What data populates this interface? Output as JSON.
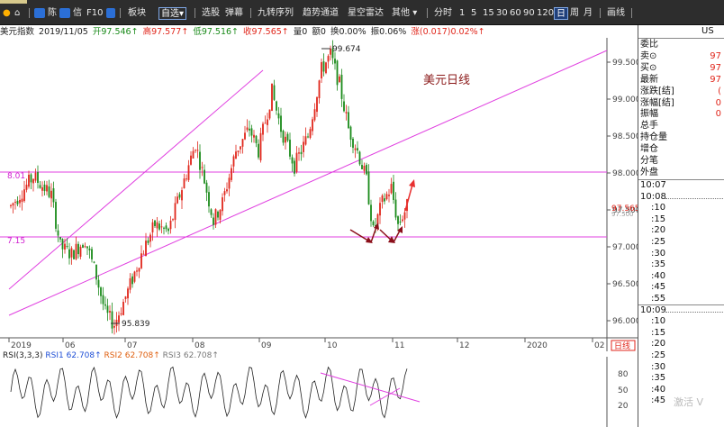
{
  "toolbar": {
    "items": [
      "板块",
      "自选",
      "选股",
      "弹幕",
      "九转序列",
      "趋势通道",
      "星空雷达",
      "其他"
    ],
    "icon_labels": [
      "陈",
      "信",
      "F10"
    ],
    "periods": [
      "分时",
      "1",
      "5",
      "15",
      "30",
      "60",
      "90",
      "120",
      "日",
      "周",
      "月"
    ],
    "active_period": "日",
    "draw_tool": "画线"
  },
  "info": {
    "title": "美元指数",
    "date": "2019/11/05",
    "open": "开97.546↑",
    "high": "高97.577↑",
    "low": "低97.516↑",
    "close": "收97.565↑",
    "volume": "量0",
    "amount": "额0",
    "change_pct": "换0.00%",
    "amplitude": "振0.06%",
    "change": "涨(0.017)0.02%↑"
  },
  "chart": {
    "annotation": "美元日线",
    "high_label": "99.674",
    "low_label": "95.839",
    "price_tag": "97.565",
    "price_tag_sub": "97.500",
    "left_label_upper": "8.01",
    "left_label_lower": "7.15",
    "period_badge": "日线",
    "colors": {
      "up": "#e0261b",
      "down": "#1a8a1a",
      "channel": "#e040e0",
      "arrow_dark": "#8b0f1a",
      "arrow_red": "#e83030"
    }
  },
  "chart_data": {
    "type": "candlestick",
    "title": "美元日线",
    "y_ticks": [
      "99.500",
      "99.000",
      "98.500",
      "98.000",
      "97.500",
      "97.000",
      "96.500",
      "96.000"
    ],
    "x_ticks": [
      "2019",
      "06",
      "07",
      "08",
      "09",
      "10",
      "11",
      "12",
      "2020",
      "02"
    ],
    "ylim": [
      95.7,
      100.0
    ],
    "high": 99.674,
    "low": 95.839,
    "last_close": 97.565,
    "horizontal_levels": [
      98.01,
      97.15
    ]
  },
  "rsi": {
    "label": "RSI(3,3,3)",
    "rsi1": "RSI1 62.708↑",
    "rsi2": "RSI2 62.708↑",
    "rsi3": "RSI3 62.708↑",
    "y_ticks": [
      "80",
      "50",
      "20"
    ]
  },
  "panel": {
    "symbol": "US",
    "rows": [
      {
        "label": "委比",
        "value": ""
      },
      {
        "label": "卖⊙",
        "value": "97"
      },
      {
        "label": "买⊙",
        "value": "97"
      },
      {
        "label": "最新",
        "value": "97"
      },
      {
        "label": "涨跌[结]",
        "value": "("
      },
      {
        "label": "涨幅[结]",
        "value": "0"
      },
      {
        "label": "振幅",
        "value": "0"
      },
      {
        "label": "总手",
        "value": ""
      },
      {
        "label": "持仓量",
        "value": ""
      },
      {
        "label": "增仓",
        "value": ""
      },
      {
        "label": "分笔",
        "value": ""
      },
      {
        "label": "外盘",
        "value": ""
      }
    ],
    "times": [
      "10:07",
      "10:08",
      ":10",
      ":15",
      ":20",
      ":25",
      ":30",
      ":35",
      ":40",
      ":45",
      ":55",
      "10:09",
      ":10",
      ":15",
      ":20",
      ":25",
      ":30",
      ":35",
      ":40",
      ":45"
    ]
  },
  "watermark": "激活 V"
}
